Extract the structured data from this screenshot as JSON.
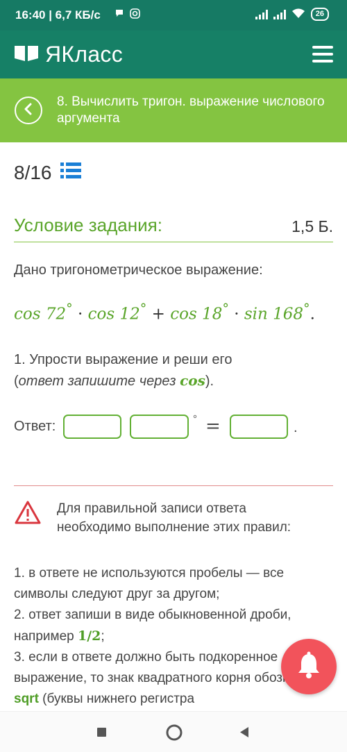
{
  "status_bar": {
    "time": "16:40 | 6,7 КБ/с",
    "battery": "26"
  },
  "app_bar": {
    "brand": "ЯКласс"
  },
  "task_header": {
    "title": "8. Вычислить тригон. выражение числового аргумента"
  },
  "progress": {
    "count": "8/16"
  },
  "condition": {
    "title": "Условие задания:",
    "points": "1,5 Б."
  },
  "task": {
    "given": "Дано тригонометрическое выражение:",
    "expression": {
      "t1": "cos 72",
      "t2": "cos 12",
      "t3": "cos 18",
      "t4": "sin 168",
      "deg": "°",
      "mul": "·",
      "plus": "+",
      "end": "."
    },
    "step1_line1": "1. Упрости выражение и реши его",
    "step1_open": "(",
    "step1_italic": "ответ запишите через ",
    "step1_cos": "cos",
    "step1_close": ")."
  },
  "answer": {
    "label": "Ответ:",
    "deg": "°",
    "eq": "=",
    "period": "."
  },
  "rules": {
    "intro": "Для правильной записи ответа необходимо выполнение этих правил:",
    "r1": "1. в ответе не используются пробелы — все символы следуют друг за другом;",
    "r2a": "2. ответ запиши в виде обыкновенной дроби, например ",
    "r2b": "1/2",
    "r2c": ";",
    "r3a": "3. если в ответе должно быть подкоренное выражение, то знак квадратного корня обозначаем ",
    "r3b": "sqrt",
    "r3c": " (буквы нижнего регистра"
  },
  "colors": {
    "status": "#167a64",
    "appbar": "#168066",
    "task_header": "#84c441",
    "accent_green": "#5aa52a",
    "warning_red": "#d9363e",
    "bell": "#f2535b"
  },
  "icons": [
    "chat-icon",
    "instagram-icon",
    "signal-icon",
    "wifi-icon",
    "battery-icon",
    "book-icon",
    "menu-icon",
    "back-arrow-icon",
    "list-icon",
    "warning-icon",
    "bell-icon",
    "square-icon",
    "circle-icon",
    "triangle-back-icon"
  ]
}
